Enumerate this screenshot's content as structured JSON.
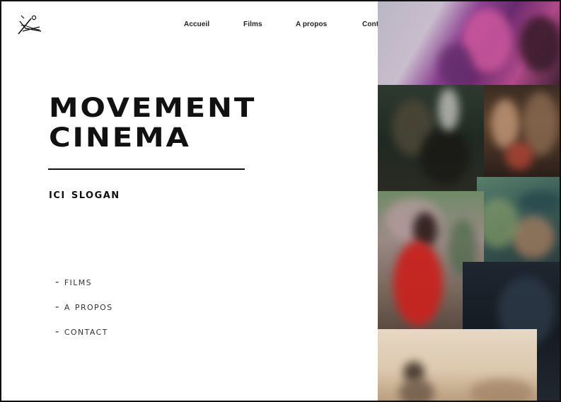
{
  "header": {
    "logo": "brush-logo-icon",
    "nav": [
      {
        "label": "Accueil"
      },
      {
        "label": "Films"
      },
      {
        "label": "A propos"
      },
      {
        "label": "Contact"
      }
    ]
  },
  "hero": {
    "title_line1": "MOVEMENT",
    "title_line2": "CINEMA",
    "slogan": "ICI SLOGan"
  },
  "side_menu": {
    "items": [
      {
        "dash": "-",
        "label": "FILMS"
      },
      {
        "dash": "-",
        "label": "A PrOPOS"
      },
      {
        "dash": "-",
        "label": "CONTACT"
      }
    ]
  },
  "collage": {
    "images": [
      "film-still-purple",
      "film-still-dark-room",
      "film-still-portrait",
      "film-still-red-coat",
      "film-still-man-cap",
      "film-still-dark-blue",
      "film-still-beige"
    ]
  },
  "colors": {
    "text": "#111111",
    "background": "#ffffff",
    "border": "#111111"
  }
}
